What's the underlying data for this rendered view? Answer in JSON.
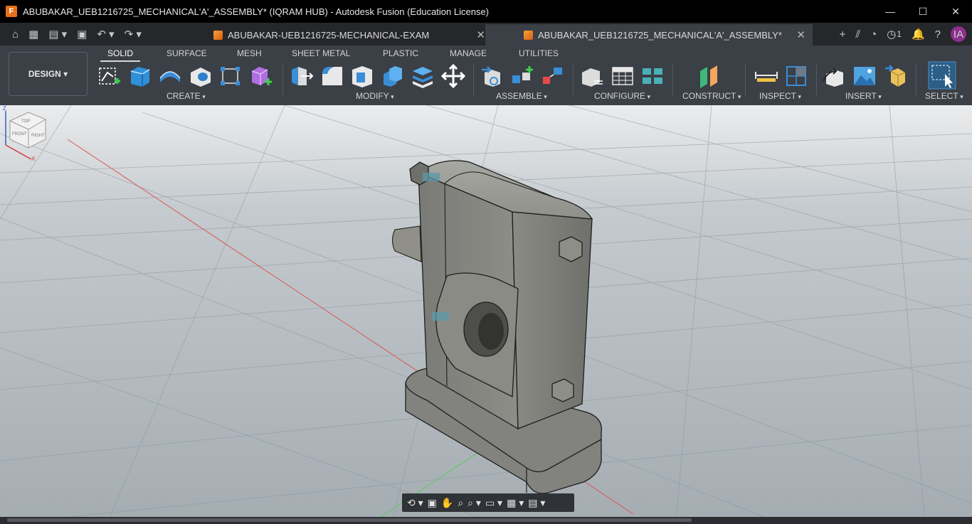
{
  "window": {
    "title": "ABUBAKAR_UEB1216725_MECHANICAL'A'_ASSEMBLY* (IQRAM HUB) - Autodesk Fusion (Education License)",
    "logo_letter": "F",
    "controls": {
      "minimize": "—",
      "maximize": "☐",
      "close": "✕"
    }
  },
  "quick_access": {
    "home": "⌂",
    "grid": "▦",
    "file": "▤ ▾",
    "save": "▣",
    "undo": "↶ ▾",
    "redo": "↷ ▾"
  },
  "tabs": [
    {
      "label": "ABUBAKAR-UEB1216725-MECHANICAL-EXAM",
      "close": "✕"
    },
    {
      "label": "ABUBAKAR_UEB1216725_MECHANICAL'A'_ASSEMBLY*",
      "close": "✕"
    }
  ],
  "right_icons": {
    "add": "+",
    "sketch": "⫽",
    "speed": "◔",
    "jobs": "◷",
    "jobs_count": "1",
    "bell": "🔔",
    "help": "?",
    "avatar": "IA"
  },
  "workspace": {
    "label": "DESIGN ▾"
  },
  "workspace_tabs": [
    "SOLID",
    "SURFACE",
    "MESH",
    "SHEET METAL",
    "PLASTIC",
    "MANAGE",
    "UTILITIES"
  ],
  "groups": [
    "CREATE",
    "MODIFY",
    "ASSEMBLE",
    "CONFIGURE",
    "CONSTRUCT",
    "INSPECT",
    "INSERT",
    "SELECT"
  ],
  "viewcube": {
    "top": "TOP",
    "front": "FRONT",
    "right": "RIGHT",
    "axis_z": "Z",
    "axis_x": "X"
  },
  "navbar": {
    "orbit": "⟲ ▾",
    "look": "▣",
    "pan": "✋",
    "zoom": "⌕",
    "fit": "⌕ ▾",
    "display": "▭ ▾",
    "grid": "▦ ▾",
    "views": "▤ ▾"
  },
  "colors": {
    "accent": "#e8701a",
    "toolbar": "#3b3f46",
    "titlebar": "#000000",
    "avatar": "#8c2f8f"
  }
}
